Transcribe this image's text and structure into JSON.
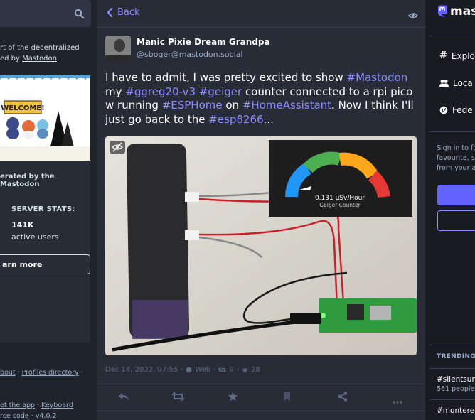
{
  "left": {
    "about_line1": "rt of the decentralized",
    "about_line2_prefix": "ed by ",
    "about_link": "Mastodon",
    "about_suffix": ".",
    "hero_sign": "WELCOME!",
    "hosted_text": "erated by the Mastodon",
    "stats_title": "SERVER STATS:",
    "stats_value": "141K",
    "stats_label": "active users",
    "learn_more": "arn more",
    "footer": [
      {
        "text": "bout",
        "sep": " · "
      },
      {
        "text": "Profiles directory",
        "sep": " ·"
      }
    ],
    "footer2a": "et the app",
    "footer2b": "Keyboard",
    "footer3a": "rce code",
    "footer3b": "v4.0.2"
  },
  "header": {
    "back_label": "Back"
  },
  "post": {
    "display_name": "Manic Pixie Dream Grandpa",
    "handle": "@sboger@mastodon.social",
    "content_parts": [
      {
        "text": "I have to admit, I was pretty excited to show ",
        "tag": false
      },
      {
        "text": "#Mastodon",
        "tag": true
      },
      {
        "text": " my ",
        "tag": false
      },
      {
        "text": "#ggreg20-v3",
        "tag": true
      },
      {
        "text": " ",
        "tag": false
      },
      {
        "text": "#geiger",
        "tag": true
      },
      {
        "text": " counter connected to a rpi pico w running ",
        "tag": false
      },
      {
        "text": "#ESPHome",
        "tag": true
      },
      {
        "text": " on ",
        "tag": false
      },
      {
        "text": "#HomeAssistant",
        "tag": true
      },
      {
        "text": ". Now I think I'll just go back to the ",
        "tag": false
      },
      {
        "text": "#esp8266",
        "tag": true
      },
      {
        "text": "...",
        "tag": false
      }
    ],
    "gauge_value": "0.131 µSv/Hour",
    "gauge_label": "Geiger Counter",
    "date": "Dec 14, 2022, 07:55",
    "visibility": "Web",
    "boosts": "9",
    "favourites": "28"
  },
  "right": {
    "logo_text": "masto",
    "nav": [
      {
        "label": "Explo",
        "icon": "hashtag-icon"
      },
      {
        "label": "Loca",
        "icon": "users-icon"
      },
      {
        "label": "Fede",
        "icon": "globe-icon"
      }
    ],
    "signin_lines": [
      "Sign in to fo",
      "favourite, s",
      "from your a"
    ],
    "trending_title": "TRENDING N",
    "trends": [
      {
        "tag": "#silentsun",
        "sub": "561 people"
      },
      {
        "tag": "#montereyl",
        "sub": ""
      }
    ]
  },
  "colors": {
    "accent": "#8c8dff",
    "brand": "#6364ff",
    "background": "#191b22",
    "column": "#282c37"
  }
}
